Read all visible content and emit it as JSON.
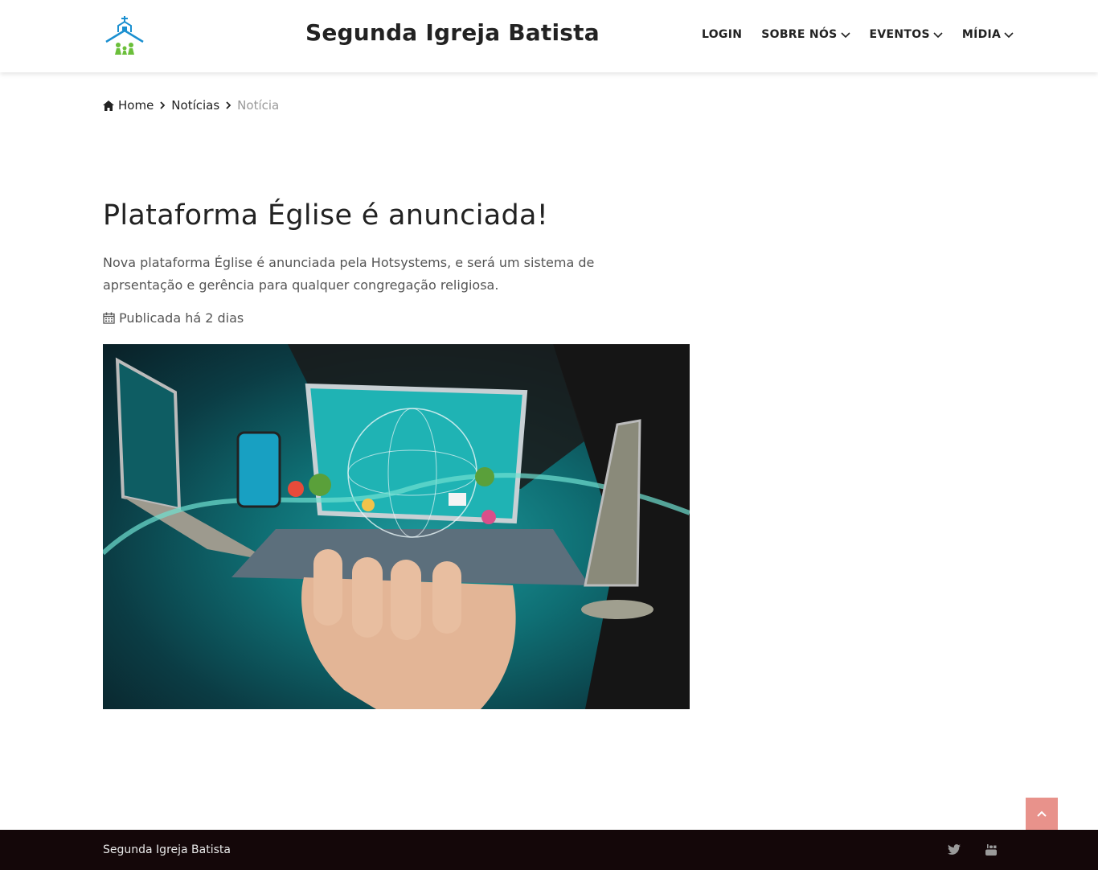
{
  "header": {
    "site_title": "Segunda Igreja Batista",
    "logo_icon": "church-logo-icon",
    "nav": {
      "login": "LOGIN",
      "about": "SOBRE NÓS",
      "events": "EVENTOS",
      "media": "MÍDIA"
    }
  },
  "breadcrumb": {
    "home": "Home",
    "news": "Notícias",
    "current": "Notícia"
  },
  "article": {
    "title": "Plataforma Église é anunciada!",
    "summary": "Nova plataforma Église é anunciada pela Hotsystems, e será um sistema de aprsentação e gerência para qualquer congregação religiosa.",
    "date": "Publicada há 2 dias"
  },
  "footer": {
    "text": "Segunda Igreja Batista",
    "social": [
      "twitter-icon",
      "youtube-icon"
    ]
  },
  "colors": {
    "back_to_top": "#e8928b",
    "footer_bg": "#140709",
    "breadcrumb_current": "#999999"
  }
}
